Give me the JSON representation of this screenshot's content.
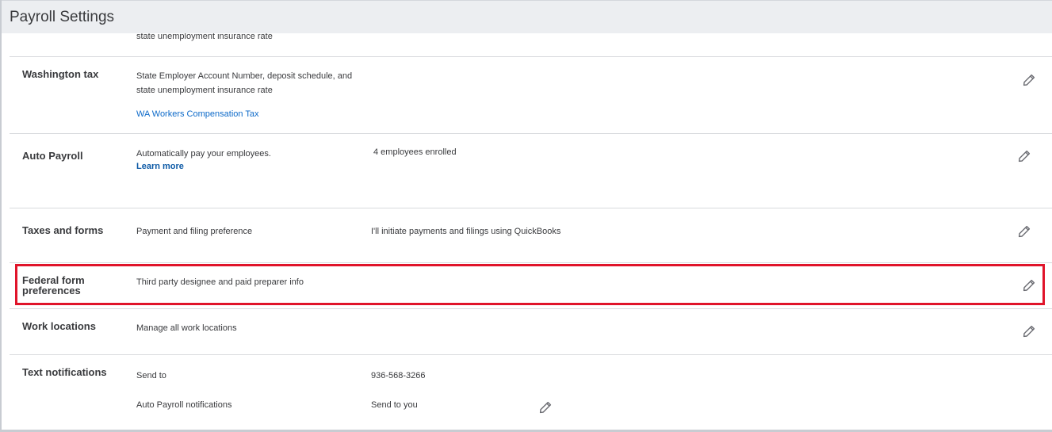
{
  "header": {
    "title": "Payroll Settings"
  },
  "partial_row": {
    "text": "state unemployment insurance rate"
  },
  "rows": {
    "washington_tax": {
      "label": "Washington tax",
      "desc_line1": "State Employer Account Number, deposit schedule, and",
      "desc_line2": "state unemployment insurance rate",
      "link": "WA Workers Compensation Tax",
      "edit_icon": "pencil-icon"
    },
    "auto_payroll": {
      "label": "Auto Payroll",
      "desc": "Automatically pay your employees.",
      "link": "Learn more",
      "value": "4 employees enrolled",
      "edit_icon": "pencil-icon"
    },
    "taxes_forms": {
      "label": "Taxes and forms",
      "desc": "Payment and filing preference",
      "value": "I'll initiate payments and filings using QuickBooks",
      "edit_icon": "pencil-icon"
    },
    "federal_form": {
      "label_line1": "Federal form",
      "label_line2": "preferences",
      "desc": "Third party designee and paid preparer info",
      "edit_icon": "pencil-icon"
    },
    "work_locations": {
      "label": "Work locations",
      "desc": "Manage all work locations",
      "edit_icon": "pencil-icon"
    },
    "text_notifications": {
      "label": "Text notifications",
      "send_to_label": "Send to",
      "send_to_value": "936-568-3266",
      "auto_payroll_label": "Auto Payroll notifications",
      "auto_payroll_value": "Send to you",
      "edit_icon": "pencil-icon"
    }
  },
  "colors": {
    "header_bg": "#eceef1",
    "highlight": "#e0142a",
    "link": "#0d6ac9",
    "text": "#393a3d"
  }
}
